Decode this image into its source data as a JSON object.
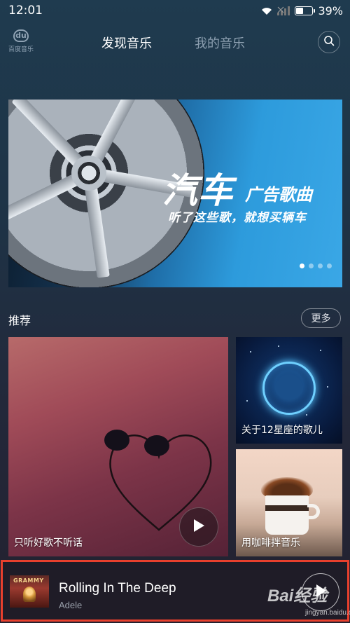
{
  "status_bar": {
    "time": "12:01",
    "battery": "39%",
    "battery_level": 0.39
  },
  "header": {
    "logo_caption": "百度音乐",
    "logo_mark": "du",
    "tabs": [
      {
        "label": "发现音乐",
        "active": true
      },
      {
        "label": "我的音乐",
        "active": false
      }
    ],
    "search_icon": "search-icon"
  },
  "banner": {
    "title_main": "汽车",
    "title_tail": "广告歌曲",
    "subtitle": "听了这些歌，就想买辆车",
    "page_count": 4,
    "active_page": 1
  },
  "recommend": {
    "title": "推荐",
    "more_label": "更多",
    "cards": [
      {
        "label": "只听好歌不听话",
        "has_play": true
      },
      {
        "label": "关于12星座的歌儿"
      },
      {
        "label": "用咖啡拌音乐"
      }
    ]
  },
  "now_playing": {
    "song": "Rolling In The Deep",
    "artist": "Adele",
    "album_text": "GRAMMY"
  },
  "watermark": {
    "text": "Bai经验",
    "sub": "jingyan.baidu.com"
  },
  "colors": {
    "highlight_border": "#e8402d",
    "accent_blue": "#2d9bdc"
  }
}
